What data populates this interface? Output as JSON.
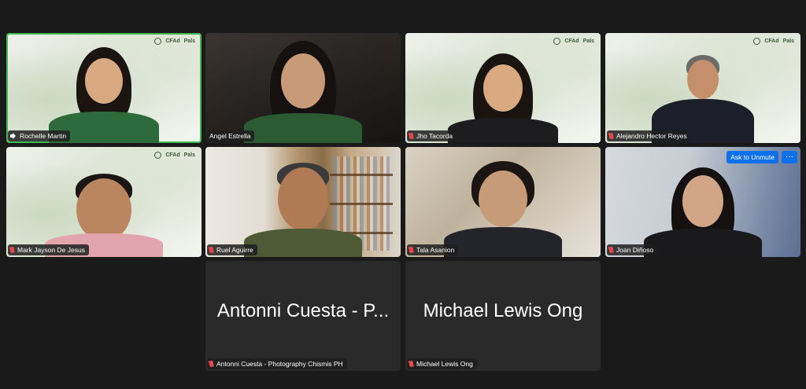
{
  "logo": {
    "left": "CFAd",
    "right": "Pals"
  },
  "tiles": [
    {
      "name": "Rochelle Martin"
    },
    {
      "name": "Angel Estrella"
    },
    {
      "name": "Jho Tacorda"
    },
    {
      "name": "Alejandro Hector Reyes"
    },
    {
      "name": "Mark Jayson De Jesus"
    },
    {
      "name": "Ruel Aguirre"
    },
    {
      "name": "Tala Asanion"
    },
    {
      "name": "Joan Diñoso",
      "ask_to_unmute": "Ask to Unmute",
      "more": "···"
    },
    {
      "name": "Antonni Cuesta - Photography Chismis PH",
      "display": "Antonni Cuesta - P..."
    },
    {
      "name": "Michael Lewis Ong",
      "display": "Michael Lewis Ong"
    }
  ],
  "colors": {
    "active_border": "#3fb950",
    "muted_mic": "#e5484d",
    "button_blue": "#0e71eb"
  }
}
